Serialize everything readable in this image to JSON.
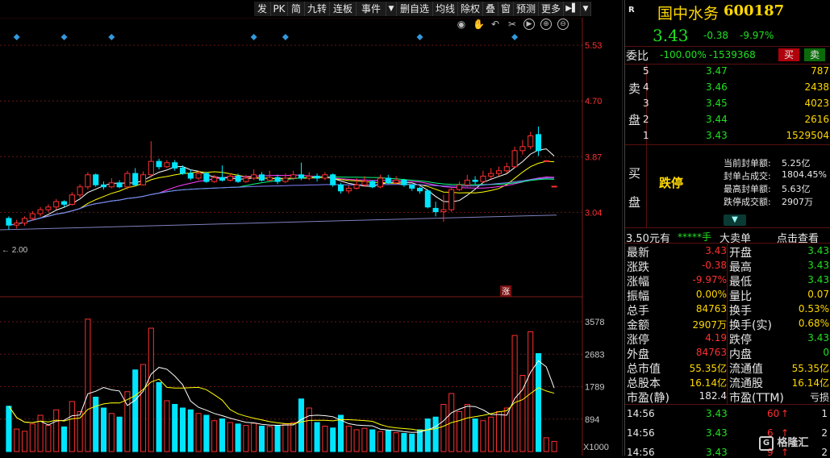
{
  "toolbar": {
    "items": [
      "发",
      "PK",
      "简",
      "九转",
      "连板",
      "事件",
      "删自选",
      "均线",
      "除权",
      "叠",
      "窗",
      "预测",
      "更多"
    ],
    "dropdown_glyph": "▼",
    "more_arrow_glyph": "▶▌",
    "icons": [
      "eye-icon",
      "hand-icon",
      "undo-icon",
      "scissors-icon",
      "play-icon",
      "zoom-in-icon",
      "zoom-out-icon"
    ]
  },
  "stock": {
    "badge": "R",
    "name": "国中水务",
    "code": "600187",
    "price": "3.43",
    "change": "-0.38",
    "change_pct": "-9.97%"
  },
  "commission": {
    "label": "委比",
    "ratio": "-100.00%",
    "diff": "-1539368",
    "buy_btn": "买",
    "sell_btn": "卖"
  },
  "sell_side": {
    "label_chars": [
      "卖",
      "盘"
    ],
    "levels": [
      {
        "level": "5",
        "price": "3.47",
        "volume": "787"
      },
      {
        "level": "4",
        "price": "3.46",
        "volume": "2438"
      },
      {
        "level": "3",
        "price": "3.45",
        "volume": "4023"
      },
      {
        "level": "2",
        "price": "3.44",
        "volume": "2616"
      },
      {
        "level": "1",
        "price": "3.43",
        "volume": "1529504"
      }
    ]
  },
  "buy_side": {
    "label_chars": [
      "买",
      "盘"
    ],
    "status": "跌停",
    "seal": [
      {
        "label": "当前封单额:",
        "value": "5.25亿"
      },
      {
        "label": "封单占成交:",
        "value": "1804.45%"
      },
      {
        "label": "最高封单额:",
        "value": "5.63亿"
      },
      {
        "label": "跌停成交额:",
        "value": "2907万"
      }
    ]
  },
  "big_order": {
    "left": "3.50元有",
    "masked": "*****手",
    "mid": "大卖单",
    "right": "点击查看"
  },
  "quote": {
    "rows": [
      {
        "l1": "最新",
        "v1": "3.43",
        "c1": "red",
        "l2": "开盘",
        "v2": "3.43",
        "c2": "green"
      },
      {
        "l1": "涨跌",
        "v1": "-0.38",
        "c1": "red",
        "l2": "最高",
        "v2": "3.43",
        "c2": "green"
      },
      {
        "l1": "涨幅",
        "v1": "-9.97%",
        "c1": "red",
        "l2": "最低",
        "v2": "3.43",
        "c2": "green"
      },
      {
        "l1": "振幅",
        "v1": "0.00%",
        "c1": "yellow",
        "l2": "量比",
        "v2": "0.07",
        "c2": "yellow"
      },
      {
        "l1": "总手",
        "v1": "84763",
        "c1": "yellow",
        "l2": "换手",
        "v2": "0.53%",
        "c2": "yellow"
      },
      {
        "l1": "金额",
        "v1": "2907万",
        "c1": "yellow",
        "l2": "换手(实)",
        "v2": "0.68%",
        "c2": "yellow"
      },
      {
        "l1": "涨停",
        "v1": "4.19",
        "c1": "red",
        "l2": "跌停",
        "v2": "3.43",
        "c2": "green"
      },
      {
        "l1": "外盘",
        "v1": "84763",
        "c1": "red",
        "l2": "内盘",
        "v2": "0",
        "c2": "green"
      },
      {
        "l1": "总市值",
        "v1": "55.35亿",
        "c1": "yellow",
        "l2": "流通值",
        "v2": "55.35亿",
        "c2": "yellow"
      },
      {
        "l1": "总股本",
        "v1": "16.14亿",
        "c1": "yellow",
        "l2": "流通股",
        "v2": "16.14亿",
        "c2": "yellow"
      },
      {
        "l1": "市盈(静)",
        "v1": "182.4",
        "c1": "white",
        "l2": "市盈(TTM)",
        "v2": "亏损",
        "c2": "white"
      }
    ]
  },
  "ticks": [
    {
      "time": "14:56",
      "price": "3.43",
      "vol": "60",
      "arrow": "↑",
      "num": "1"
    },
    {
      "time": "14:56",
      "price": "3.43",
      "vol": "6",
      "arrow": "↑",
      "num": "2"
    },
    {
      "time": "14:56",
      "price": "3.43",
      "vol": "9",
      "arrow": "↑",
      "num": "2"
    }
  ],
  "watermark": "格隆汇",
  "colors": {
    "up": "#ff3030",
    "down": "#00e5ff",
    "ma5": "#ffffff",
    "ma10": "#ffff00",
    "ma20": "#ff40ff",
    "ma30": "#00ff80",
    "ma60": "#8080ff",
    "marker": "#3399dd"
  },
  "chart_data": {
    "type": "candlestick",
    "price_axis_ticks": [
      "5.53",
      "4.70",
      "3.87",
      "3.04"
    ],
    "volume_axis_ticks": [
      "3578",
      "2683",
      "1789",
      "894"
    ],
    "volume_unit": "X1000",
    "low_annotation": "← 2.00",
    "flag_label": "涨",
    "ylim": [
      2.6,
      5.7
    ],
    "vol_max": 4000,
    "candles": [
      {
        "o": 2.95,
        "c": 2.85,
        "h": 2.98,
        "l": 2.78,
        "v": 1250
      },
      {
        "o": 2.85,
        "c": 2.88,
        "h": 2.93,
        "l": 2.8,
        "v": 620
      },
      {
        "o": 2.88,
        "c": 2.95,
        "h": 2.98,
        "l": 2.84,
        "v": 560
      },
      {
        "o": 2.95,
        "c": 3.02,
        "h": 3.06,
        "l": 2.92,
        "v": 760
      },
      {
        "o": 3.02,
        "c": 3.08,
        "h": 3.12,
        "l": 2.98,
        "v": 1000
      },
      {
        "o": 3.08,
        "c": 3.12,
        "h": 3.16,
        "l": 3.04,
        "v": 720
      },
      {
        "o": 3.12,
        "c": 3.2,
        "h": 3.24,
        "l": 3.08,
        "v": 1150
      },
      {
        "o": 3.2,
        "c": 3.16,
        "h": 3.22,
        "l": 3.12,
        "v": 680
      },
      {
        "o": 3.16,
        "c": 3.3,
        "h": 3.34,
        "l": 3.14,
        "v": 1380
      },
      {
        "o": 3.3,
        "c": 3.42,
        "h": 3.46,
        "l": 3.26,
        "v": 1100
      },
      {
        "o": 3.42,
        "c": 3.6,
        "h": 3.64,
        "l": 3.38,
        "v": 3650
      },
      {
        "o": 3.6,
        "c": 3.45,
        "h": 3.62,
        "l": 3.42,
        "v": 1500
      },
      {
        "o": 3.45,
        "c": 3.42,
        "h": 3.5,
        "l": 3.38,
        "v": 1200
      },
      {
        "o": 3.42,
        "c": 3.48,
        "h": 3.55,
        "l": 3.4,
        "v": 1050
      },
      {
        "o": 3.48,
        "c": 3.42,
        "h": 3.52,
        "l": 3.4,
        "v": 950
      },
      {
        "o": 3.42,
        "c": 3.62,
        "h": 3.66,
        "l": 3.38,
        "v": 1650
      },
      {
        "o": 3.62,
        "c": 3.45,
        "h": 3.7,
        "l": 3.43,
        "v": 2250
      },
      {
        "o": 3.45,
        "c": 3.6,
        "h": 3.65,
        "l": 3.44,
        "v": 2400
      },
      {
        "o": 3.6,
        "c": 3.8,
        "h": 4.1,
        "l": 3.56,
        "v": 3400
      },
      {
        "o": 3.8,
        "c": 3.72,
        "h": 3.84,
        "l": 3.68,
        "v": 1900
      },
      {
        "o": 3.72,
        "c": 3.78,
        "h": 3.82,
        "l": 3.7,
        "v": 1400
      },
      {
        "o": 3.78,
        "c": 3.7,
        "h": 3.82,
        "l": 3.66,
        "v": 1300
      },
      {
        "o": 3.7,
        "c": 3.62,
        "h": 3.74,
        "l": 3.6,
        "v": 1200
      },
      {
        "o": 3.62,
        "c": 3.55,
        "h": 3.68,
        "l": 3.52,
        "v": 1150
      },
      {
        "o": 3.55,
        "c": 3.62,
        "h": 3.66,
        "l": 3.52,
        "v": 1050
      },
      {
        "o": 3.62,
        "c": 3.5,
        "h": 3.64,
        "l": 3.48,
        "v": 1000
      },
      {
        "o": 3.5,
        "c": 3.56,
        "h": 3.6,
        "l": 3.48,
        "v": 850
      },
      {
        "o": 3.56,
        "c": 3.52,
        "h": 3.74,
        "l": 3.5,
        "v": 900
      },
      {
        "o": 3.52,
        "c": 3.58,
        "h": 3.62,
        "l": 3.5,
        "v": 800
      },
      {
        "o": 3.58,
        "c": 3.5,
        "h": 3.62,
        "l": 3.48,
        "v": 760
      },
      {
        "o": 3.5,
        "c": 3.55,
        "h": 3.6,
        "l": 3.48,
        "v": 720
      },
      {
        "o": 3.55,
        "c": 3.6,
        "h": 3.68,
        "l": 3.52,
        "v": 780
      },
      {
        "o": 3.6,
        "c": 3.52,
        "h": 3.64,
        "l": 3.5,
        "v": 700
      },
      {
        "o": 3.52,
        "c": 3.56,
        "h": 3.66,
        "l": 3.5,
        "v": 690
      },
      {
        "o": 3.56,
        "c": 3.5,
        "h": 3.6,
        "l": 3.46,
        "v": 720
      },
      {
        "o": 3.5,
        "c": 3.55,
        "h": 3.62,
        "l": 3.48,
        "v": 760
      },
      {
        "o": 3.55,
        "c": 3.6,
        "h": 3.66,
        "l": 3.52,
        "v": 800
      },
      {
        "o": 3.6,
        "c": 3.55,
        "h": 3.78,
        "l": 3.52,
        "v": 1450
      },
      {
        "o": 3.55,
        "c": 3.58,
        "h": 3.64,
        "l": 3.52,
        "v": 1200
      },
      {
        "o": 3.58,
        "c": 3.55,
        "h": 3.62,
        "l": 3.5,
        "v": 800
      },
      {
        "o": 3.55,
        "c": 3.6,
        "h": 3.64,
        "l": 3.52,
        "v": 700
      },
      {
        "o": 3.6,
        "c": 3.45,
        "h": 3.62,
        "l": 3.42,
        "v": 650
      },
      {
        "o": 3.45,
        "c": 3.36,
        "h": 3.48,
        "l": 3.32,
        "v": 1000
      },
      {
        "o": 3.36,
        "c": 3.4,
        "h": 3.44,
        "l": 3.32,
        "v": 700
      },
      {
        "o": 3.4,
        "c": 3.45,
        "h": 3.55,
        "l": 3.38,
        "v": 600
      },
      {
        "o": 3.45,
        "c": 3.5,
        "h": 3.58,
        "l": 3.42,
        "v": 640
      },
      {
        "o": 3.5,
        "c": 3.42,
        "h": 3.52,
        "l": 3.4,
        "v": 600
      },
      {
        "o": 3.42,
        "c": 3.55,
        "h": 3.6,
        "l": 3.4,
        "v": 550
      },
      {
        "o": 3.55,
        "c": 3.48,
        "h": 3.6,
        "l": 3.46,
        "v": 580
      },
      {
        "o": 3.48,
        "c": 3.52,
        "h": 3.58,
        "l": 3.46,
        "v": 520
      },
      {
        "o": 3.52,
        "c": 3.45,
        "h": 3.54,
        "l": 3.42,
        "v": 500
      },
      {
        "o": 3.45,
        "c": 3.4,
        "h": 3.46,
        "l": 3.36,
        "v": 480
      },
      {
        "o": 3.4,
        "c": 3.36,
        "h": 3.42,
        "l": 3.32,
        "v": 600
      },
      {
        "o": 3.36,
        "c": 3.12,
        "h": 3.38,
        "l": 3.1,
        "v": 900
      },
      {
        "o": 3.1,
        "c": 3.05,
        "h": 3.2,
        "l": 2.98,
        "v": 950
      },
      {
        "o": 3.05,
        "c": 3.08,
        "h": 3.3,
        "l": 2.9,
        "v": 1300
      },
      {
        "o": 3.08,
        "c": 3.38,
        "h": 3.42,
        "l": 3.05,
        "v": 1600
      },
      {
        "o": 3.38,
        "c": 3.45,
        "h": 3.5,
        "l": 3.36,
        "v": 1100
      },
      {
        "o": 3.45,
        "c": 3.52,
        "h": 3.6,
        "l": 3.42,
        "v": 1300
      },
      {
        "o": 3.52,
        "c": 3.5,
        "h": 3.58,
        "l": 3.46,
        "v": 900
      },
      {
        "o": 3.5,
        "c": 3.58,
        "h": 3.66,
        "l": 3.48,
        "v": 850
      },
      {
        "o": 3.58,
        "c": 3.62,
        "h": 3.7,
        "l": 3.54,
        "v": 950
      },
      {
        "o": 3.62,
        "c": 3.66,
        "h": 3.72,
        "l": 3.58,
        "v": 1100
      },
      {
        "o": 3.66,
        "c": 3.72,
        "h": 3.78,
        "l": 3.62,
        "v": 1200
      },
      {
        "o": 3.72,
        "c": 3.96,
        "h": 4.02,
        "l": 3.7,
        "v": 3200
      },
      {
        "o": 3.96,
        "c": 4.02,
        "h": 4.12,
        "l": 3.9,
        "v": 2100
      },
      {
        "o": 4.02,
        "c": 4.18,
        "h": 4.24,
        "l": 3.98,
        "v": 3300
      },
      {
        "o": 4.2,
        "c": 3.96,
        "h": 4.32,
        "l": 3.88,
        "v": 2700
      },
      {
        "o": 3.81,
        "c": 3.81,
        "h": 3.81,
        "l": 3.81,
        "v": 380
      },
      {
        "o": 3.43,
        "c": 3.43,
        "h": 3.43,
        "l": 3.43,
        "v": 280
      }
    ]
  }
}
